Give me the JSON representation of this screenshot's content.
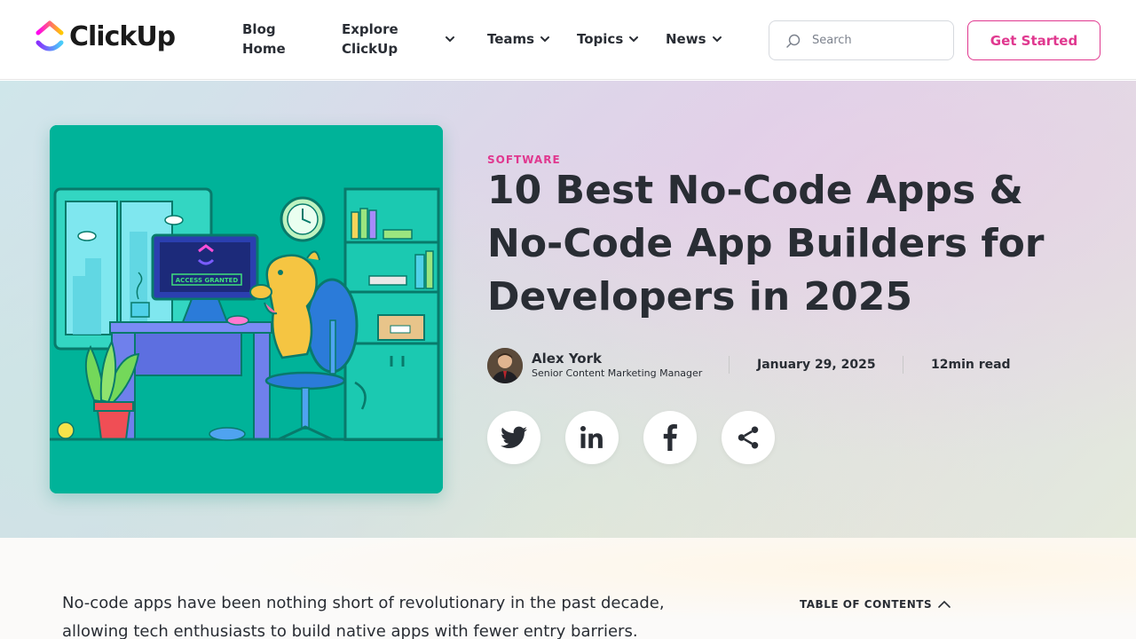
{
  "header": {
    "logo_text": "ClickUp",
    "nav": {
      "blog_home_line1": "Blog",
      "blog_home_line2": "Home",
      "explore_line1": "Explore",
      "explore_line2": "ClickUp",
      "teams": "Teams",
      "topics": "Topics",
      "news": "News"
    },
    "search_placeholder": "Search",
    "cta_label": "Get Started"
  },
  "hero": {
    "category": "SOFTWARE",
    "title": "10 Best No-Code Apps & No-Code App Builders for Developers in 2025",
    "illustration_text": "ACCESS GRANTED",
    "author": {
      "name": "Alex York",
      "role": "Senior Content Marketing Manager"
    },
    "date": "January 29, 2025",
    "read_time": "12min read",
    "share_icons": [
      "twitter-icon",
      "linkedin-icon",
      "facebook-icon",
      "share-icon"
    ]
  },
  "content": {
    "intro": "No-code apps have been nothing short of revolutionary in the past decade, allowing tech enthusiasts to build native apps with fewer entry barriers.",
    "toc_label": "TABLE OF CONTENTS"
  },
  "colors": {
    "accent_pink": "#e0388f",
    "text_dark": "#292d34",
    "illustration_teal": "#00b399"
  }
}
